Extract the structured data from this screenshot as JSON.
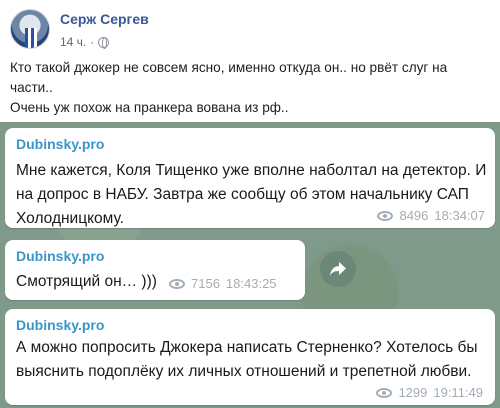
{
  "post": {
    "author": "Серж Сергев",
    "time": "14 ч.",
    "separator": "·",
    "privacy_icon": "globe-icon",
    "text_line1": "Кто такой джокер не совсем ясно, именно откуда он.. но рвёт слуг на части..",
    "text_line2": "Очень уж похож на пранкера вована из рф.."
  },
  "messages": [
    {
      "channel": "Dubinsky.pro",
      "text": "Мне кажется, Коля Тищенко уже вполне наболтал на детектор. И на допрос в НАБУ. Завтра же сообщу об этом начальнику САП Холодницкому.",
      "views": "8496",
      "time": "18:34:07"
    },
    {
      "channel": "Dubinsky.pro",
      "text": "Смотрящий он… )))",
      "views": "7156",
      "time": "18:43:25"
    },
    {
      "channel": "Dubinsky.pro",
      "text": "А можно попросить Джокера написать Стерненко? Хотелось бы выяснить подоплёку их личных отношений и трепетной любви.",
      "views": "1299",
      "time": "19:11:49"
    }
  ],
  "colors": {
    "author": "#385898",
    "channel": "#3a95c9",
    "chat_background": "#7f9a8a",
    "meta": "#a3adb6"
  }
}
